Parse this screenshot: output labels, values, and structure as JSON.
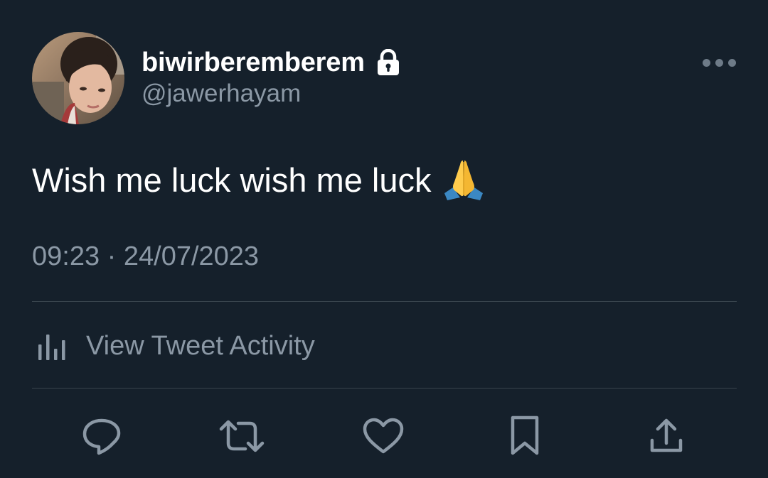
{
  "user": {
    "display_name": "biwirberemberem",
    "handle": "@jawerhayam",
    "protected_icon": "lock-icon",
    "avatar_icon": "user-avatar-photo"
  },
  "tweet": {
    "text": "Wish me luck wish me luck",
    "emoji": "🙏",
    "timestamp": "09:23 · 24/07/2023"
  },
  "activity": {
    "label": "View Tweet Activity",
    "icon": "bar-chart-icon"
  },
  "actions": [
    {
      "name": "reply",
      "icon": "speech-bubble-icon"
    },
    {
      "name": "retweet",
      "icon": "retweet-icon"
    },
    {
      "name": "like",
      "icon": "heart-icon"
    },
    {
      "name": "bookmark",
      "icon": "bookmark-icon"
    },
    {
      "name": "share",
      "icon": "upload-icon"
    }
  ],
  "colors": {
    "background": "#15202b",
    "primary_text": "#ffffff",
    "secondary_text": "#8b98a5",
    "divider": "#38444d",
    "icon": "#8b98a5"
  }
}
